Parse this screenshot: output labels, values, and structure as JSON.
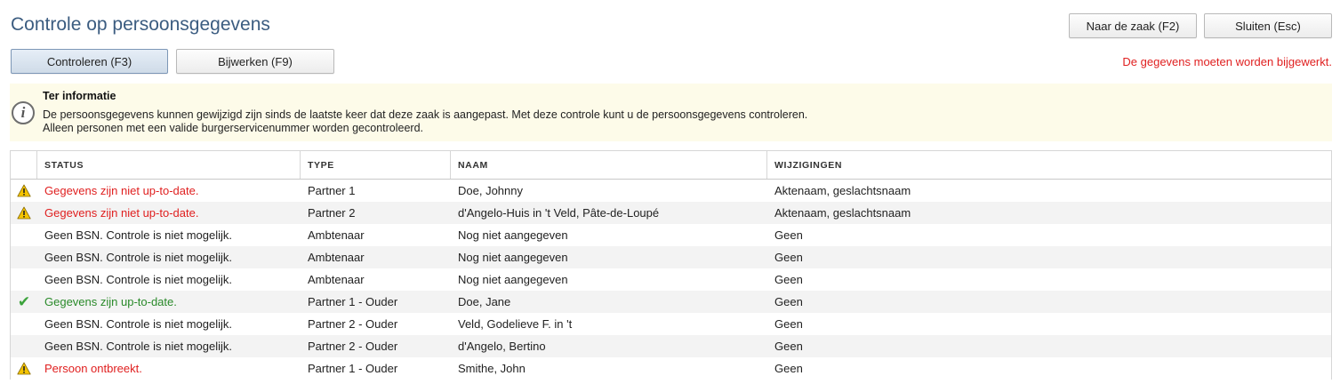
{
  "header": {
    "title": "Controle op persoonsgegevens",
    "btn_zaak": "Naar de zaak (F2)",
    "btn_sluiten": "Sluiten (Esc)"
  },
  "toolbar": {
    "btn_controleren": "Controleren (F3)",
    "btn_bijwerken": "Bijwerken (F9)",
    "message": "De gegevens moeten worden bijgewerkt."
  },
  "info": {
    "title": "Ter informatie",
    "line1": "De persoonsgegevens kunnen gewijzigd zijn sinds de laatste keer dat deze zaak is aangepast. Met deze controle kunt u de persoonsgegevens controleren.",
    "line2": "Alleen personen met een valide burgerservicenummer worden gecontroleerd."
  },
  "table": {
    "columns": [
      "STATUS",
      "TYPE",
      "NAAM",
      "WIJZIGINGEN"
    ],
    "rows": [
      {
        "icon": "warning-icon",
        "status": "Gegevens zijn niet up-to-date.",
        "type": "Partner 1",
        "naam": "Doe, Johnny",
        "wijzigingen": "Aktenaam, geslachtsnaam"
      },
      {
        "icon": "warning-icon",
        "status": "Gegevens zijn niet up-to-date.",
        "type": "Partner 2",
        "naam": "d'Angelo-Huis in 't Veld, Pâte-de-Loupé",
        "wijzigingen": "Aktenaam, geslachtsnaam"
      },
      {
        "icon": "",
        "status": "Geen BSN. Controle is niet mogelijk.",
        "type": "Ambtenaar",
        "naam": "Nog niet aangegeven",
        "wijzigingen": "Geen"
      },
      {
        "icon": "",
        "status": "Geen BSN. Controle is niet mogelijk.",
        "type": "Ambtenaar",
        "naam": "Nog niet aangegeven",
        "wijzigingen": "Geen"
      },
      {
        "icon": "",
        "status": "Geen BSN. Controle is niet mogelijk.",
        "type": "Ambtenaar",
        "naam": "Nog niet aangegeven",
        "wijzigingen": "Geen"
      },
      {
        "icon": "check-icon",
        "status": "Gegevens zijn up-to-date.",
        "type": "Partner 1 - Ouder",
        "naam": "Doe, Jane",
        "wijzigingen": "Geen"
      },
      {
        "icon": "",
        "status": "Geen BSN. Controle is niet mogelijk.",
        "type": "Partner 2 - Ouder",
        "naam": "Veld, Godelieve F. in 't",
        "wijzigingen": "Geen"
      },
      {
        "icon": "",
        "status": "Geen BSN. Controle is niet mogelijk.",
        "type": "Partner 2 - Ouder",
        "naam": "d'Angelo, Bertino",
        "wijzigingen": "Geen"
      },
      {
        "icon": "warning-icon",
        "status": "Persoon ontbreekt.",
        "type": "Partner 1 - Ouder",
        "naam": "Smithe, John",
        "wijzigingen": "Geen"
      }
    ]
  },
  "colors": {
    "title": "#3b5c80",
    "warning": "#e02020",
    "ok": "#2a8a2a",
    "info_bg": "#fdfbe9"
  }
}
